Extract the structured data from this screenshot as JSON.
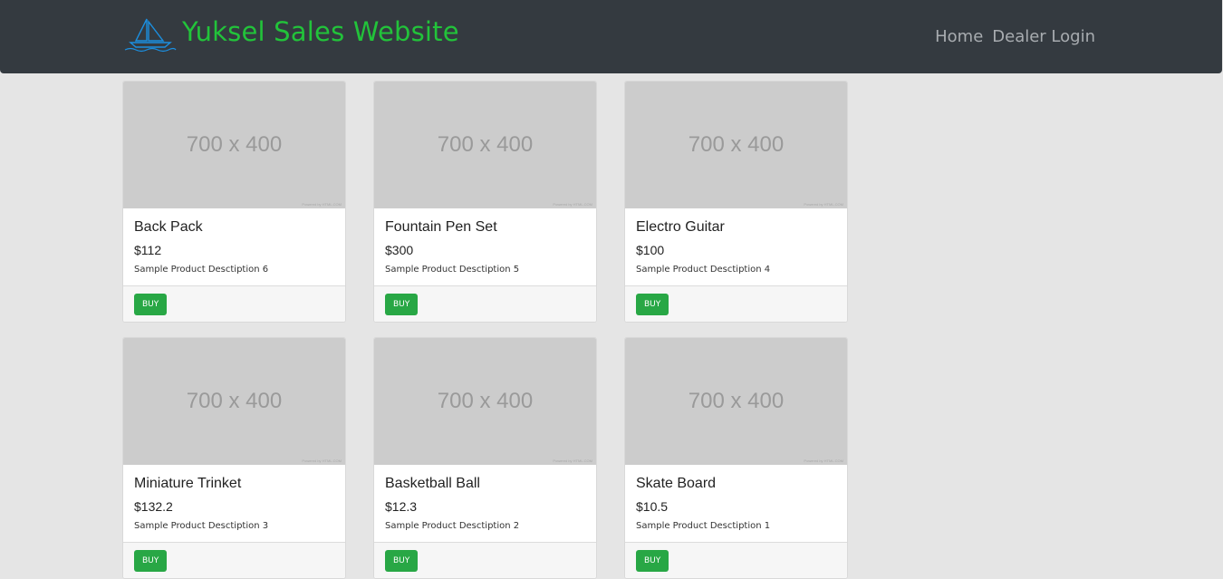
{
  "navbar": {
    "brand_title": "Yuksel Sales Website",
    "links": [
      {
        "label": "Home"
      },
      {
        "label": "Dealer Login"
      }
    ]
  },
  "products": [
    {
      "image_label": "700 x 400",
      "image_credit": "Powered by HTML.COM",
      "title": "Back Pack",
      "price": "$112",
      "description": "Sample Product Desctiption 6",
      "button": "BUY"
    },
    {
      "image_label": "700 x 400",
      "image_credit": "Powered by HTML.COM",
      "title": "Fountain Pen Set",
      "price": "$300",
      "description": "Sample Product Desctiption 5",
      "button": "BUY"
    },
    {
      "image_label": "700 x 400",
      "image_credit": "Powered by HTML.COM",
      "title": "Electro Guitar",
      "price": "$100",
      "description": "Sample Product Desctiption 4",
      "button": "BUY"
    },
    {
      "image_label": "700 x 400",
      "image_credit": "Powered by HTML.COM",
      "title": "Miniature Trinket",
      "price": "$132.2",
      "description": "Sample Product Desctiption 3",
      "button": "BUY"
    },
    {
      "image_label": "700 x 400",
      "image_credit": "Powered by HTML.COM",
      "title": "Basketball Ball",
      "price": "$12.3",
      "description": "Sample Product Desctiption 2",
      "button": "BUY"
    },
    {
      "image_label": "700 x 400",
      "image_credit": "Powered by HTML.COM",
      "title": "Skate Board",
      "price": "$10.5",
      "description": "Sample Product Desctiption 1",
      "button": "BUY"
    }
  ],
  "colors": {
    "navbar_bg": "#343a40",
    "brand": "#22c33a",
    "buy_button": "#28a745",
    "page_bg": "#e5e5e5"
  },
  "icons": {
    "brand_logo": "sailboat-logo-icon"
  }
}
